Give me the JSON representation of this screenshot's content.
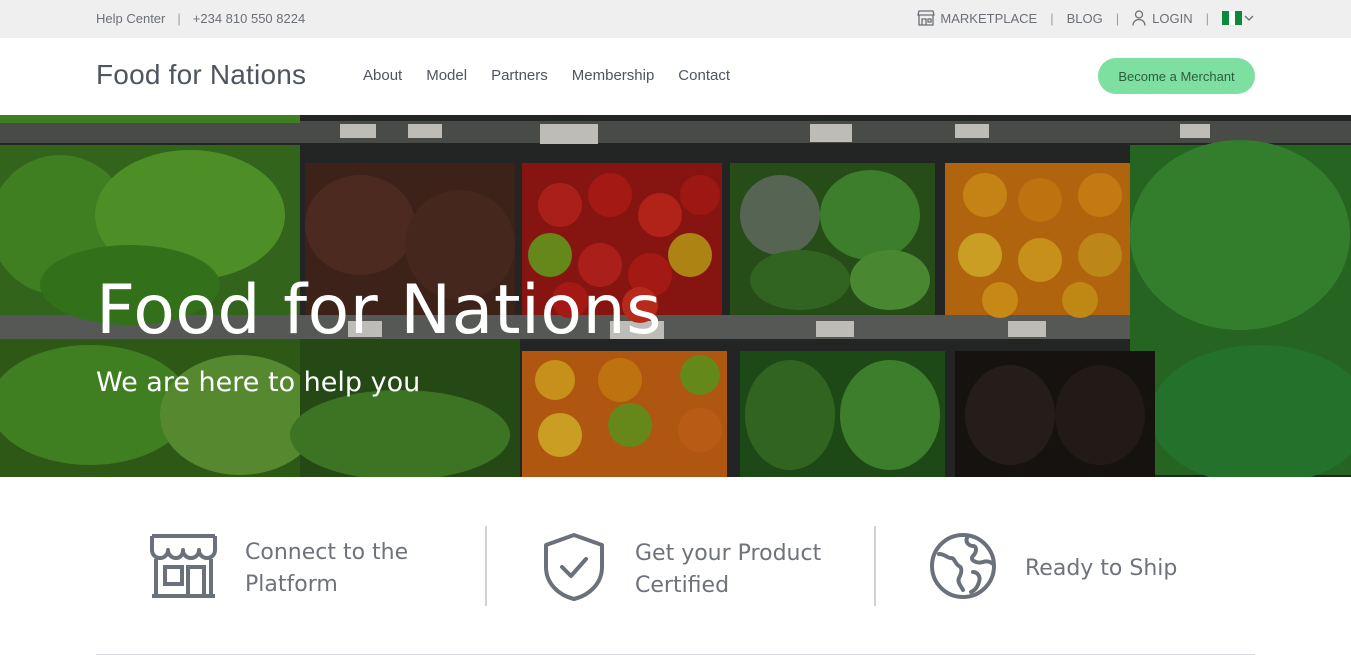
{
  "topbar": {
    "help_center": "Help Center",
    "phone": "+234 810 550 8224",
    "marketplace": "MARKETPLACE",
    "blog": "BLOG",
    "login": "LOGIN",
    "separator": "|"
  },
  "header": {
    "brand": "Food for Nations",
    "nav": [
      "About",
      "Model",
      "Partners",
      "Membership",
      "Contact"
    ],
    "cta": "Become a Merchant"
  },
  "hero": {
    "title": "Food for Nations",
    "subtitle": "We are here to help you"
  },
  "features": [
    {
      "label_line1": "Connect to the",
      "label_line2": "Platform",
      "icon": "storefront-icon"
    },
    {
      "label_line1": "Get your Product",
      "label_line2": "Certified",
      "icon": "shield-check-icon"
    },
    {
      "label_line1": "Ready to Ship",
      "label_line2": "",
      "icon": "globe-icon"
    }
  ],
  "colors": {
    "topbar_bg": "#efefef",
    "cta_bg": "#7ee0a0",
    "text": "#4e5560",
    "icon": "#6b717b"
  }
}
